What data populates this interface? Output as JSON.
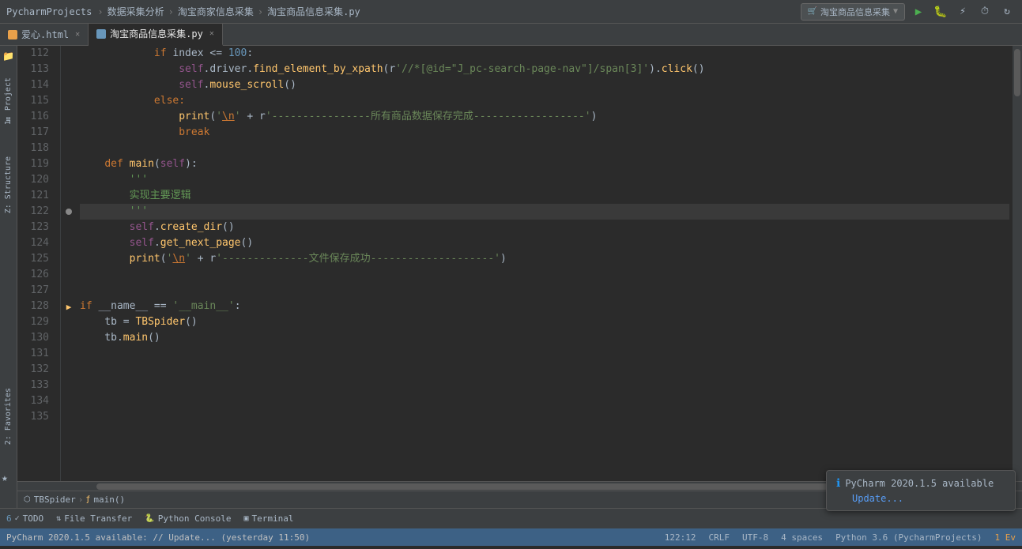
{
  "titleBar": {
    "projectName": "PycharmProjects",
    "breadcrumbs": [
      "数据采集分析",
      "淘宝商家信息采集",
      "淘宝商品信息采集.py"
    ],
    "runConfig": "淘宝商品信息采集",
    "icons": [
      "run",
      "debug",
      "coverage",
      "profile",
      "reload"
    ]
  },
  "tabs": [
    {
      "id": "tab-html",
      "label": "爱心.html",
      "type": "html",
      "active": false
    },
    {
      "id": "tab-py",
      "label": "淘宝商品信息采集.py",
      "type": "py",
      "active": true
    }
  ],
  "codeLines": [
    {
      "num": 112,
      "content": "            if index <= 100:",
      "gutter": ""
    },
    {
      "num": 113,
      "content": "                self.driver.find_element_by_xpath(r'//*[@id=\"J_pc-search-page-nav\"]/span[3]').click()",
      "gutter": ""
    },
    {
      "num": 114,
      "content": "                self.mouse_scroll()",
      "gutter": ""
    },
    {
      "num": 115,
      "content": "            else:",
      "gutter": ""
    },
    {
      "num": 116,
      "content": "                print('\\n' + r'----------------所有商品数据保存完成------------------')",
      "gutter": ""
    },
    {
      "num": 117,
      "content": "                break",
      "gutter": ""
    },
    {
      "num": 118,
      "content": "",
      "gutter": ""
    },
    {
      "num": 119,
      "content": "    def main(self):",
      "gutter": ""
    },
    {
      "num": 120,
      "content": "        '''",
      "gutter": ""
    },
    {
      "num": 121,
      "content": "        实现主要逻辑",
      "gutter": ""
    },
    {
      "num": 122,
      "content": "        '''",
      "gutter": "dot",
      "current": true
    },
    {
      "num": 123,
      "content": "        self.create_dir()",
      "gutter": ""
    },
    {
      "num": 124,
      "content": "        self.get_next_page()",
      "gutter": ""
    },
    {
      "num": 125,
      "content": "        print('\\n' + r'--------------文件保存成功--------------------')",
      "gutter": ""
    },
    {
      "num": 126,
      "content": "",
      "gutter": ""
    },
    {
      "num": 127,
      "content": "",
      "gutter": ""
    },
    {
      "num": 128,
      "content": "if __name__ == '__main__':",
      "gutter": "arrow"
    },
    {
      "num": 129,
      "content": "    tb = TBSpider()",
      "gutter": ""
    },
    {
      "num": 130,
      "content": "    tb.main()",
      "gutter": ""
    },
    {
      "num": 131,
      "content": "",
      "gutter": ""
    },
    {
      "num": 132,
      "content": "",
      "gutter": ""
    },
    {
      "num": 133,
      "content": "",
      "gutter": ""
    },
    {
      "num": 134,
      "content": "",
      "gutter": ""
    },
    {
      "num": 135,
      "content": "",
      "gutter": ""
    }
  ],
  "breadcrumbBar": {
    "items": [
      "TBSpider",
      "main()"
    ]
  },
  "bottomToolbar": {
    "todo": {
      "num": "6",
      "label": "TODO"
    },
    "fileTransfer": {
      "label": "File Transfer"
    },
    "pythonConsole": {
      "label": "Python Console"
    },
    "terminal": {
      "label": "Terminal"
    }
  },
  "statusBar": {
    "message": "PyCharm 2020.1.5 available: // Update... (yesterday 11:50)",
    "position": "122:12",
    "encoding": "CRLF",
    "charset": "UTF-8",
    "indent": "4 spaces",
    "python": "Python 3.6 (PycharmProjects)",
    "events": "1 Ev"
  },
  "notification": {
    "title": "PyCharm 2020.1.5 available",
    "link": "Update..."
  },
  "colors": {
    "accent": "#2196f3",
    "bg": "#2b2b2b",
    "toolbar": "#3c3f41",
    "statusBg": "#3d6185"
  }
}
